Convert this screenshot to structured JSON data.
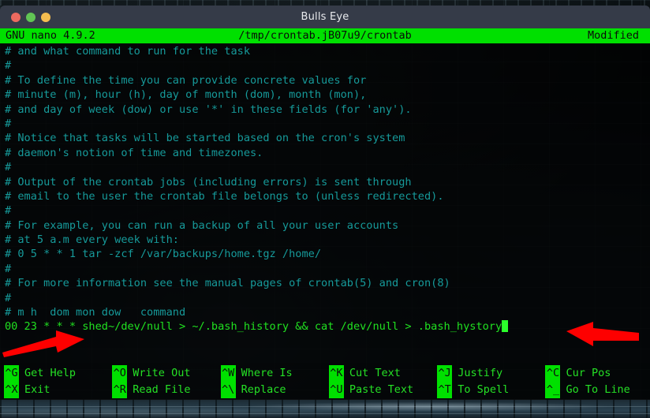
{
  "window": {
    "title": "Bulls Eye",
    "buttons": [
      {
        "name": "close",
        "color": "#ed6a5f"
      },
      {
        "name": "minimize",
        "color": "#61c554"
      },
      {
        "name": "maximize",
        "color": "#f5bd4f"
      }
    ]
  },
  "editor": {
    "status_bar": {
      "version": "GNU nano 4.9.2",
      "filename": "/tmp/crontab.jB07u9/crontab",
      "modified": "Modified",
      "background_color": "#00e000",
      "text_color": "#0a0a0a"
    },
    "comment_color": "#169a9a",
    "command_color": "#20e020",
    "cursor_color": "#2bff2b",
    "lines": [
      {
        "text": "# and what command to run for the task",
        "kind": "comment"
      },
      {
        "text": "#",
        "kind": "comment"
      },
      {
        "text": "# To define the time you can provide concrete values for",
        "kind": "comment"
      },
      {
        "text": "# minute (m), hour (h), day of month (dom), month (mon),",
        "kind": "comment"
      },
      {
        "text": "# and day of week (dow) or use '*' in these fields (for 'any').",
        "kind": "comment"
      },
      {
        "text": "#",
        "kind": "comment"
      },
      {
        "text": "# Notice that tasks will be started based on the cron's system",
        "kind": "comment"
      },
      {
        "text": "# daemon's notion of time and timezones.",
        "kind": "comment"
      },
      {
        "text": "#",
        "kind": "comment"
      },
      {
        "text": "# Output of the crontab jobs (including errors) is sent through",
        "kind": "comment"
      },
      {
        "text": "# email to the user the crontab file belongs to (unless redirected).",
        "kind": "comment"
      },
      {
        "text": "#",
        "kind": "comment"
      },
      {
        "text": "# For example, you can run a backup of all your user accounts",
        "kind": "comment"
      },
      {
        "text": "# at 5 a.m every week with:",
        "kind": "comment"
      },
      {
        "text": "# 0 5 * * 1 tar -zcf /var/backups/home.tgz /home/",
        "kind": "comment"
      },
      {
        "text": "#",
        "kind": "comment"
      },
      {
        "text": "# For more information see the manual pages of crontab(5) and cron(8)",
        "kind": "comment"
      },
      {
        "text": "#",
        "kind": "comment"
      },
      {
        "text": "# m h  dom mon dow   command",
        "kind": "comment"
      },
      {
        "text": "00 23 * * * shed~/dev/null > ~/.bash_history && cat /dev/null > .bash_hystory",
        "kind": "cmd",
        "cursor": true
      }
    ]
  },
  "shortcuts": {
    "row1": [
      {
        "key": "^G",
        "label": "Get Help"
      },
      {
        "key": "^O",
        "label": "Write Out"
      },
      {
        "key": "^W",
        "label": "Where Is"
      },
      {
        "key": "^K",
        "label": "Cut Text"
      },
      {
        "key": "^J",
        "label": "Justify"
      },
      {
        "key": "^C",
        "label": "Cur Pos"
      }
    ],
    "row2": [
      {
        "key": "^X",
        "label": "Exit"
      },
      {
        "key": "^R",
        "label": "Read File"
      },
      {
        "key": "^\\",
        "label": "Replace"
      },
      {
        "key": "^U",
        "label": "Paste Text"
      },
      {
        "key": "^T",
        "label": "To Spell"
      },
      {
        "key": "^_",
        "label": "Go To Line"
      }
    ]
  },
  "annotations": {
    "arrow_color": "#fe0000",
    "arrows": [
      {
        "name": "left-arrow",
        "direction": "right"
      },
      {
        "name": "right-arrow",
        "direction": "left"
      }
    ]
  }
}
